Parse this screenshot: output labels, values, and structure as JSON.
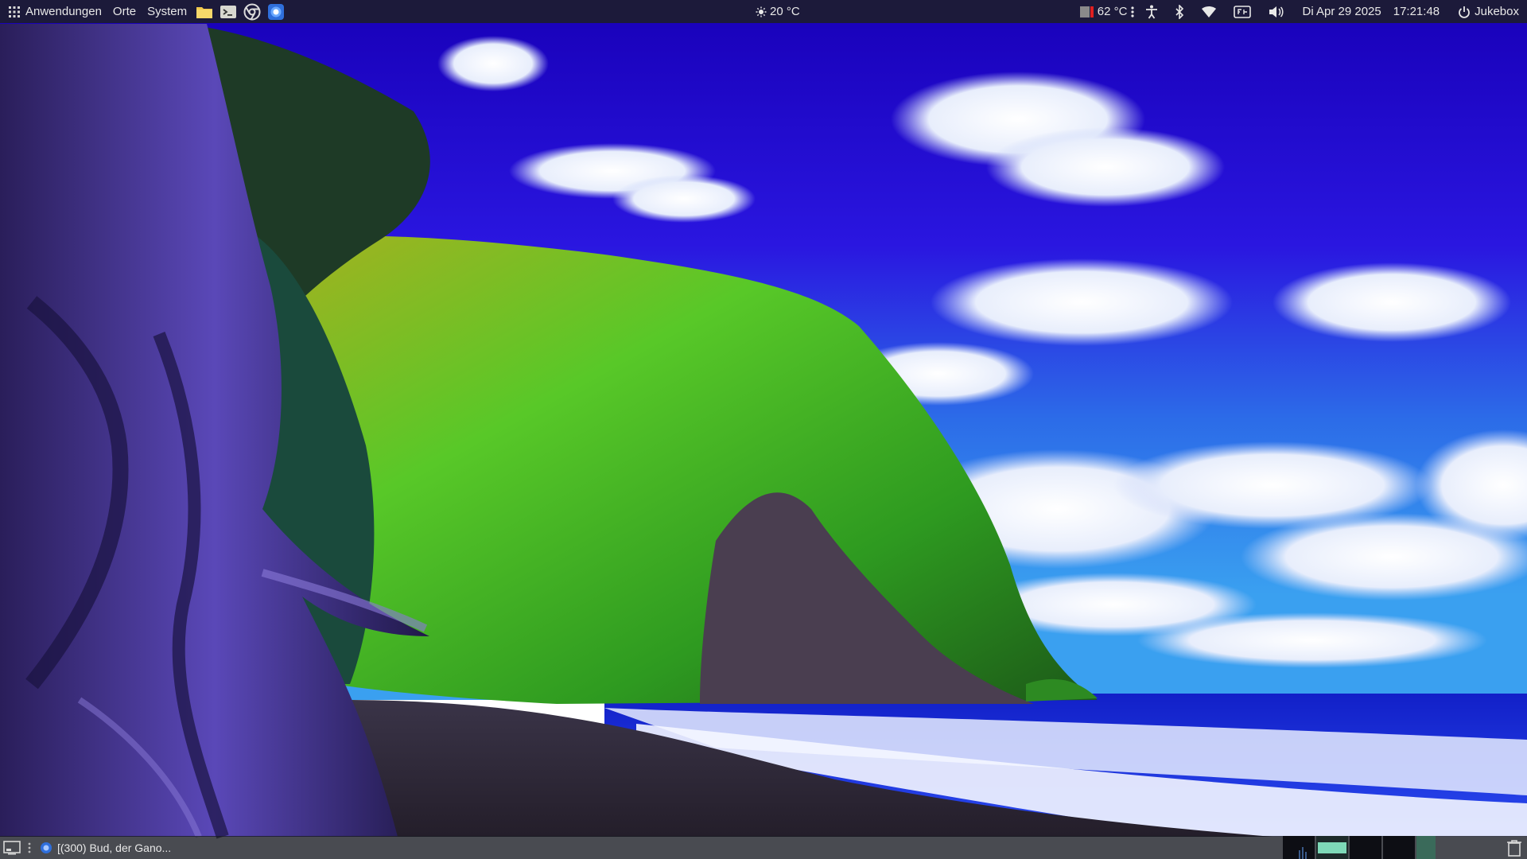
{
  "top_panel": {
    "menus": [
      "Anwendungen",
      "Orte",
      "System"
    ],
    "weather": {
      "icon": "sun-icon",
      "text": "20 °C"
    },
    "cpu_temp": {
      "icon": "thermometer-icon",
      "text": "62 °C"
    },
    "date": "Di Apr 29 2025",
    "time": "17:21:48",
    "user": "Jukebox"
  },
  "launchers": [
    {
      "name": "folder-launcher-icon"
    },
    {
      "name": "terminal-launcher-icon"
    },
    {
      "name": "chrome-launcher-icon"
    },
    {
      "name": "browser-launcher-icon"
    }
  ],
  "tray_icons": [
    "accessibility-icon",
    "bluetooth-icon",
    "wifi-icon",
    "keyboard-layout-icon",
    "volume-icon"
  ],
  "bottom_panel": {
    "task_title": "[(300) Bud, der Gano...",
    "workspaces_count": 5,
    "active_workspace": 2
  },
  "colors": {
    "panel_bg": "#1c1e28",
    "sky_top": "#1a00c8",
    "sky_mid": "#2a2ee8",
    "sea": "#1830d8",
    "hill_green": "#4cc32a"
  }
}
